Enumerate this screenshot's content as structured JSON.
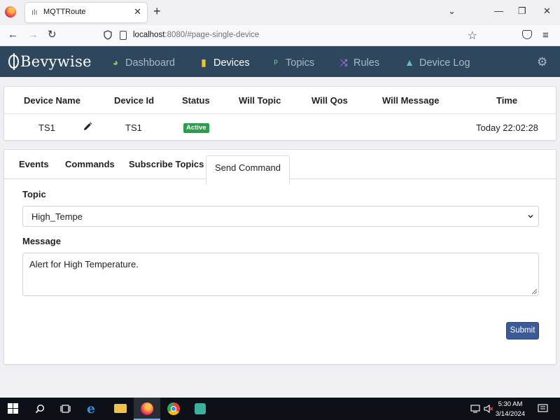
{
  "browser": {
    "tab_title": "MQTTRoute",
    "url_host": "localhost",
    "url_rest": ":8080/#page-single-device"
  },
  "app": {
    "logo": "Bevywise",
    "menu": [
      {
        "label": "Dashboard",
        "icon": "dashboard-icon",
        "color": "#8bc34a"
      },
      {
        "label": "Devices",
        "icon": "devices-icon",
        "color": "#f1c232",
        "active": true
      },
      {
        "label": "Topics",
        "icon": "topics-icon",
        "color": "#7bd88f"
      },
      {
        "label": "Rules",
        "icon": "rules-icon",
        "color": "#c77dff"
      },
      {
        "label": "Device Log",
        "icon": "warning-icon",
        "color": "#5ec2c8"
      }
    ]
  },
  "device_table": {
    "headers": [
      "Device Name",
      "Device Id",
      "Status",
      "Will Topic",
      "Will Qos",
      "Will Message",
      "Time"
    ],
    "row": {
      "device_name": "TS1",
      "device_id": "TS1",
      "status": "Active",
      "will_topic": "",
      "will_qos": "",
      "will_message": "",
      "time": "Today 22:02:28"
    }
  },
  "tabs": [
    "Events",
    "Commands",
    "Subscribe Topics",
    "Send Command"
  ],
  "active_tab": "Send Command",
  "form": {
    "topic_label": "Topic",
    "topic_value": "High_Tempe",
    "message_label": "Message",
    "message_value": "Alert for High Temperature.",
    "submit_label": "Submit"
  },
  "taskbar": {
    "time": "5:30 AM",
    "date": "3/14/2024"
  },
  "colors": {
    "header_bg": "#2e475d",
    "status_active": "#2b9e4a",
    "submit_bg": "#3d5a98"
  }
}
